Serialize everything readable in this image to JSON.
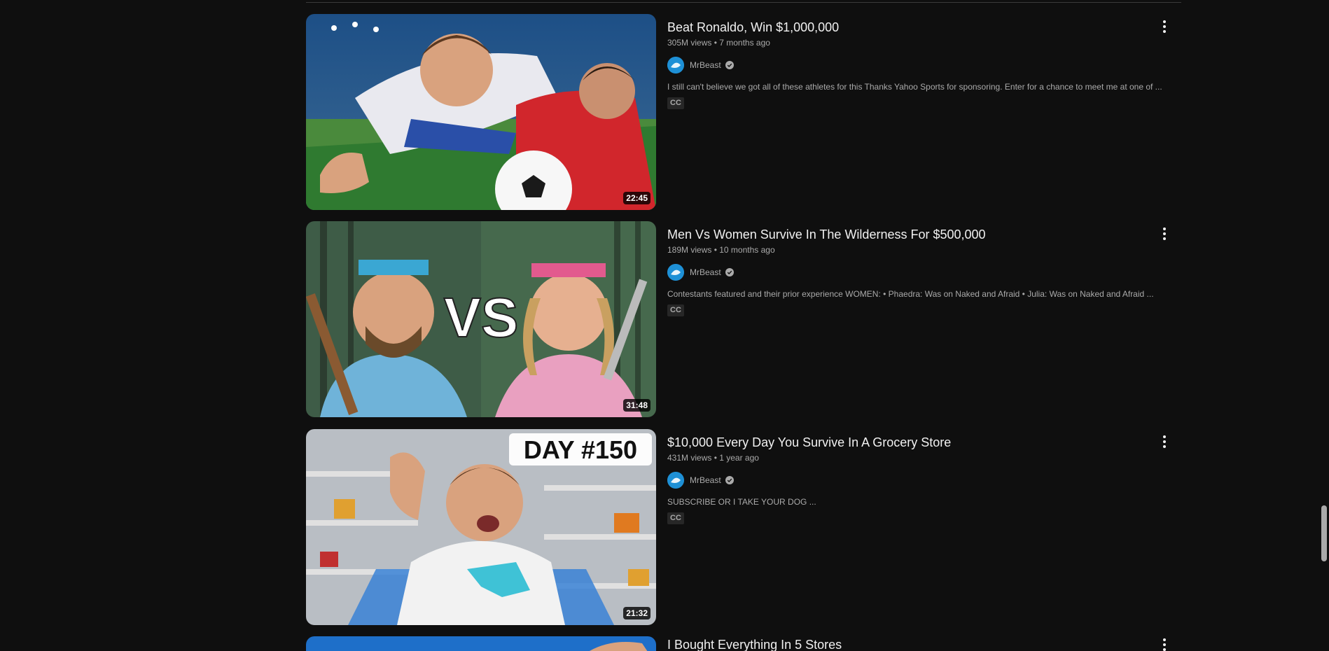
{
  "videos": [
    {
      "title": "Beat Ronaldo, Win $1,000,000",
      "stats": "305M views • 7 months ago",
      "channel": "MrBeast",
      "description": "I still can't believe we got all of these athletes for this Thanks Yahoo Sports for sponsoring. Enter for a chance to meet me at one of ...",
      "badge": "CC",
      "duration": "22:45"
    },
    {
      "title": "Men Vs Women Survive In The Wilderness For $500,000",
      "stats": "189M views • 10 months ago",
      "channel": "MrBeast",
      "description": "Contestants featured and their prior experience WOMEN: • Phaedra: Was on Naked and Afraid • Julia: Was on Naked and Afraid ...",
      "badge": "CC",
      "duration": "31:48",
      "thumb_text": "VS"
    },
    {
      "title": "$10,000 Every Day You Survive In A Grocery Store",
      "stats": "431M views • 1 year ago",
      "channel": "MrBeast",
      "description": "SUBSCRIBE OR I TAKE YOUR DOG ...",
      "badge": "CC",
      "duration": "21:32",
      "thumb_text": "DAY #150"
    },
    {
      "title": "I Bought Everything In 5 Stores"
    }
  ],
  "icons": {
    "more": "more-vert-icon",
    "verified": "verified-check-icon"
  },
  "colors": {
    "background": "#0f0f0f",
    "text_primary": "#f1f1f1",
    "text_secondary": "#aaaaaa"
  }
}
